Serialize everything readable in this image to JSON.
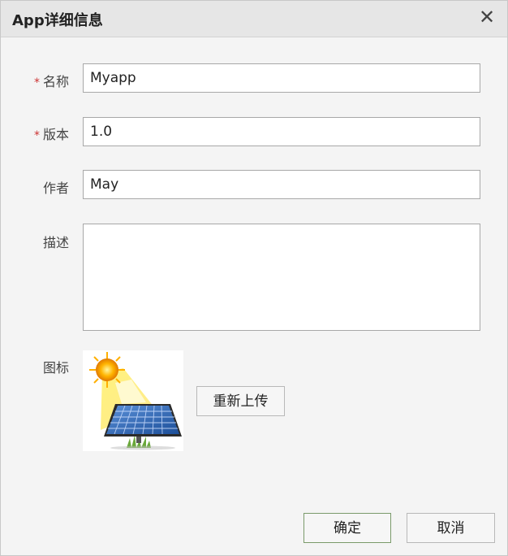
{
  "dialog": {
    "title": "App详细信息",
    "close_glyph": "✕"
  },
  "form": {
    "name": {
      "required_mark": "*",
      "label": "名称",
      "value": "Myapp"
    },
    "version": {
      "required_mark": "*",
      "label": "版本",
      "value": "1.0"
    },
    "author": {
      "label": "作者",
      "value": "May"
    },
    "description": {
      "label": "描述",
      "value": ""
    },
    "icon": {
      "label": "图标",
      "image": "solar-panel-sun-icon",
      "reupload_label": "重新上传"
    }
  },
  "footer": {
    "ok_label": "确定",
    "cancel_label": "取消"
  },
  "colors": {
    "required": "#cc3333",
    "titlebar": "#e6e6e6",
    "background": "#f4f4f4"
  }
}
